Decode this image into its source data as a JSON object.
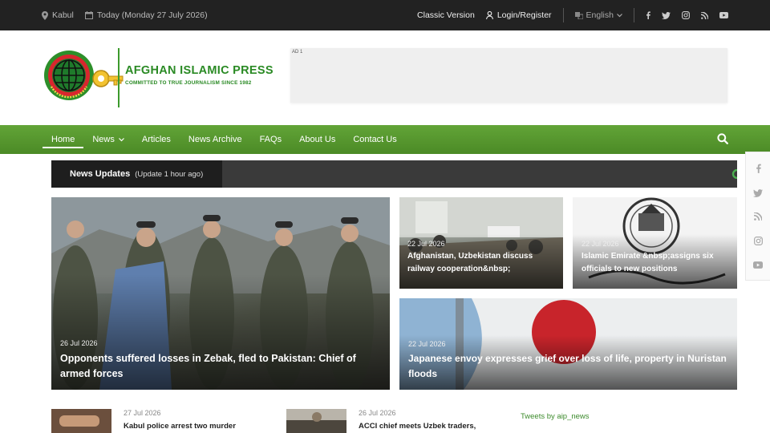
{
  "topbar": {
    "location": "Kabul",
    "date": "Today (Monday 27 July 2026)",
    "classic": "Classic Version",
    "login": "Login/Register",
    "language": "English"
  },
  "header": {
    "logo_title": "AFGHAN ISLAMIC PRESS",
    "logo_subtitle": "COMMITTED TO TRUE JOURNALISM SINCE 1982",
    "ad_label": "AD 1"
  },
  "nav": {
    "items": [
      {
        "label": "Home"
      },
      {
        "label": "News"
      },
      {
        "label": "Articles"
      },
      {
        "label": "News Archive"
      },
      {
        "label": "FAQs"
      },
      {
        "label": "About Us"
      },
      {
        "label": "Contact Us"
      }
    ]
  },
  "ticker": {
    "title": "News Updates",
    "update": "(Update 1 hour ago)"
  },
  "featured": {
    "main": {
      "date": "26 Jul 2026",
      "title": "Opponents suffered losses in Zebak, fled to Pakistan: Chief of armed forces"
    },
    "small1": {
      "date": "22 Jul 2026",
      "title": "Afghanistan, Uzbekistan discuss railway cooperation&nbsp;"
    },
    "small2": {
      "date": "22 Jul 2026",
      "title": "Islamic Emirate &nbsp;assigns six officials to new positions"
    },
    "wide": {
      "date": "22 Jul 2026",
      "title": "Japanese envoy expresses grief over loss of life, property in Nuristan floods"
    }
  },
  "latest": [
    {
      "date": "27 Jul 2026",
      "title": "Kabul police arrest two murder"
    },
    {
      "date": "26 Jul 2026",
      "title": "ACCI chief meets Uzbek traders,"
    }
  ],
  "tweets_label": "Tweets by aip_news",
  "colors": {
    "brand_green": "#4b8a26",
    "topbar": "#222222",
    "ticker_dark": "#1e1e1e"
  }
}
